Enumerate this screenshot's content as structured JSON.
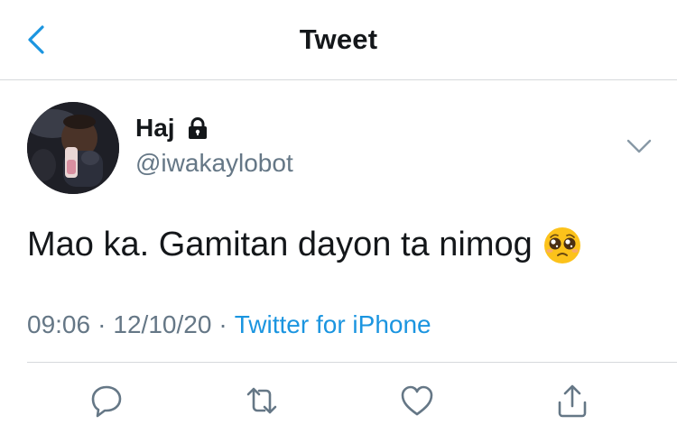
{
  "header": {
    "title": "Tweet",
    "back_icon": "chevron-left-icon",
    "accent_color": "#1b95e0"
  },
  "tweet": {
    "author": {
      "name": "Haj",
      "handle": "@iwakaylobot",
      "protected_icon": "lock-icon"
    },
    "text": "Mao ka. Gamitan dayon ta nimog",
    "emoji": "pleading-face-emoji",
    "time": "09:06",
    "date": "12/10/20",
    "separator": "·",
    "source": "Twitter for iPhone"
  },
  "actions": {
    "icons": [
      "reply-icon",
      "retweet-icon",
      "like-icon",
      "share-icon"
    ]
  },
  "colors": {
    "text_primary": "#14171a",
    "text_secondary": "#657786",
    "link": "#1b95e0",
    "divider": "#d6d9dc"
  }
}
